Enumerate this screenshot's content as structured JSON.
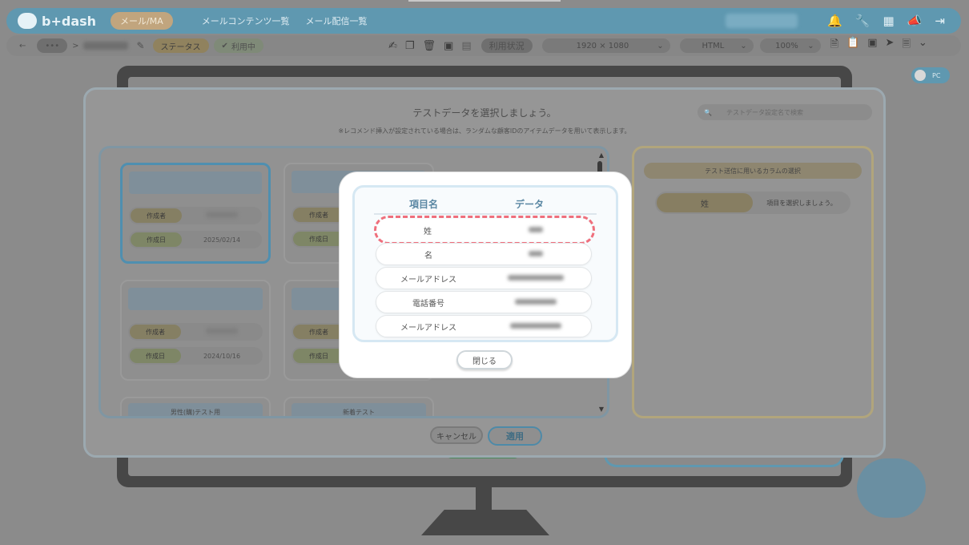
{
  "app": {
    "logo": "b+dash"
  },
  "topbar": {
    "mode_label": "メール/MA",
    "nav": [
      "メールコンテンツ一覧",
      "メール配信一覧"
    ]
  },
  "subbar": {
    "back_icon": "arrow-left-icon",
    "more": "•••",
    "breadcrumb_sep": ">",
    "status_label": "ステータス",
    "status_value": "利用中",
    "usage_button": "利用状況",
    "resolution": "1920 × 1080",
    "format": "HTML",
    "zoom": "100%"
  },
  "pc_toggle": {
    "label": "PC"
  },
  "dialog": {
    "title": "テストデータを選択しましょう。",
    "note": "※レコメンド挿入が設定されている場合は、ランダムな顧客IDのアイテムデータを用いて表示します。",
    "search_placeholder": "テストデータ設定名で検索",
    "cards": [
      {
        "row1_label": "作成者",
        "row2_label": "作成日",
        "date": "2025/02/14"
      },
      {
        "row1_label": "作成者",
        "row2_label": "作成日",
        "date": ""
      },
      {
        "row1_label": "作成者",
        "row2_label": "作成日",
        "date": "2024/10/16"
      },
      {
        "row1_label": "作成者",
        "row2_label": "作成日",
        "date": ""
      }
    ],
    "bottom_cards": [
      "男性(購)テスト用",
      "新着テスト"
    ],
    "right": {
      "header": "テスト送信に用いるカラムの選択",
      "column_key": "姓",
      "column_hint": "項目を選択しましょう。"
    },
    "cancel_label": "キャンセル",
    "apply_label": "適用"
  },
  "modal": {
    "header_item": "項目名",
    "header_data": "データ",
    "rows": [
      {
        "key": "姓"
      },
      {
        "key": "名"
      },
      {
        "key": "メールアドレス"
      },
      {
        "key": "電話番号"
      },
      {
        "key": "メールアドレス"
      }
    ],
    "close_label": "閉じる"
  },
  "colors": {
    "accent": "#5f98b0",
    "highlight": "#ef6f7c"
  }
}
